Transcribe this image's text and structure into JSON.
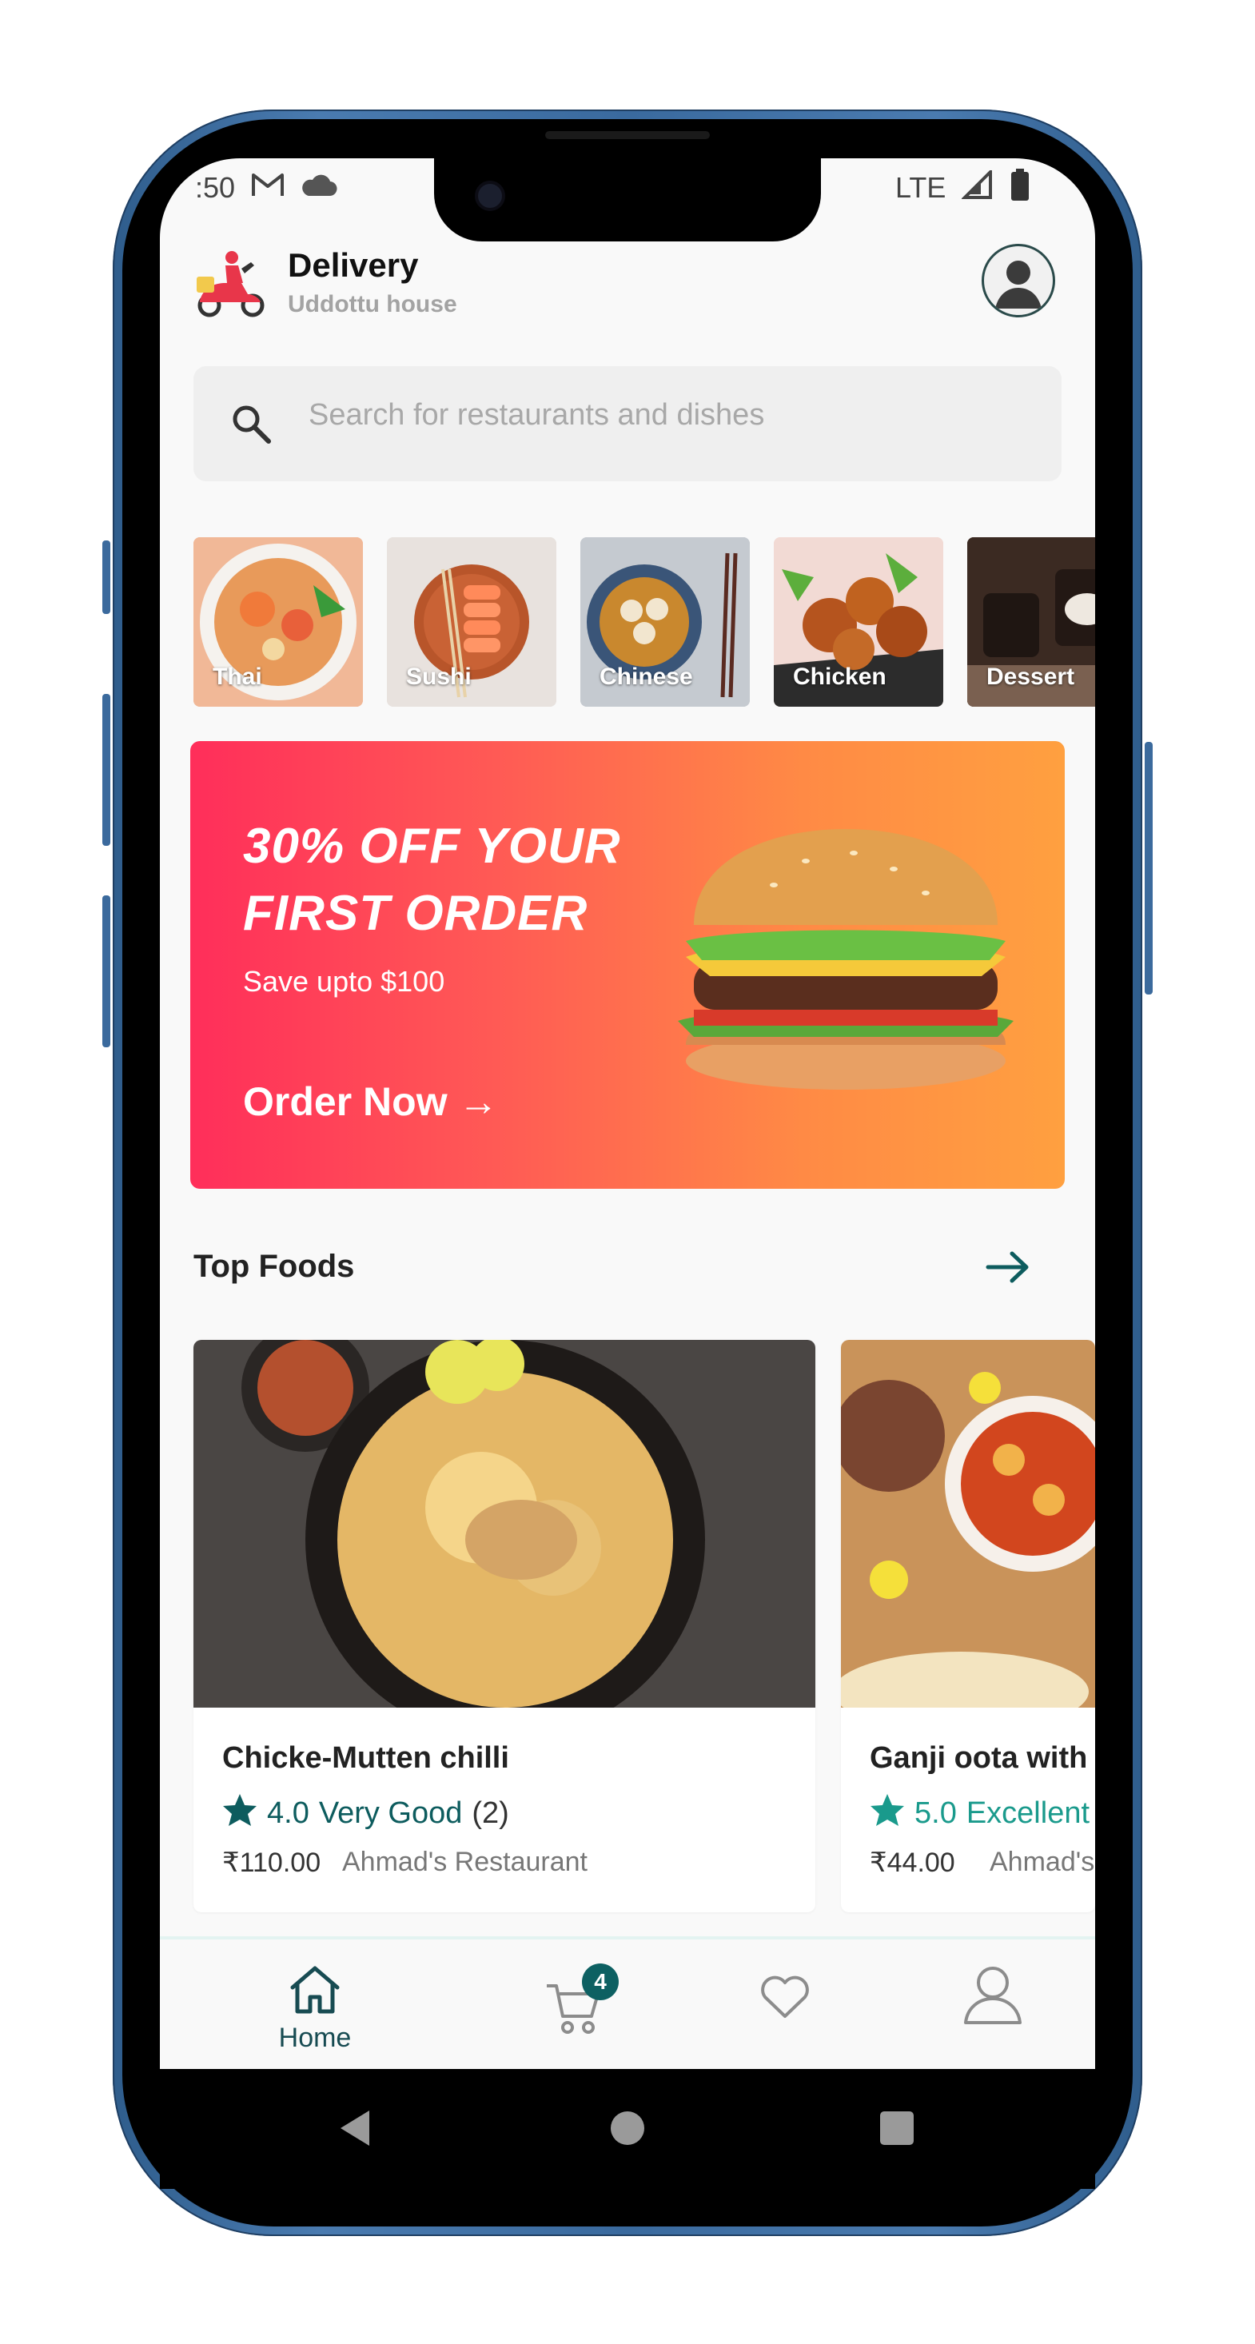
{
  "status_bar": {
    "time": ":50",
    "network": "LTE"
  },
  "header": {
    "title": "Delivery",
    "subtitle": "Uddottu house"
  },
  "search": {
    "placeholder": "Search for restaurants and dishes"
  },
  "categories": [
    {
      "label": "Thai"
    },
    {
      "label": "Sushi"
    },
    {
      "label": "Chinese"
    },
    {
      "label": "Chicken"
    },
    {
      "label": "Dessert"
    }
  ],
  "promo": {
    "headline": "30% OFF YOUR FIRST ORDER",
    "subtitle": "Save upto $100",
    "cta": "Order Now →"
  },
  "top_foods": {
    "title": "Top Foods",
    "items": [
      {
        "name": "Chicke-Mutten chilli",
        "rating": "4.0",
        "rating_label": "Very Good",
        "reviews": "(2)",
        "price": "₹110.00",
        "restaurant": "Ahmad's Restaurant",
        "rating_color": "#0d5c5e"
      },
      {
        "name": "Ganji oota with",
        "rating": "5.0",
        "rating_label": "Excellent",
        "reviews": "",
        "price": "₹44.00",
        "restaurant": "Ahmad's Restaurant",
        "rating_color": "#1a9a8c"
      }
    ]
  },
  "bottom_nav": {
    "home_label": "Home",
    "cart_count": "4"
  },
  "colors": {
    "accent": "#0d5c5e",
    "promo_start": "#ff2e5a",
    "promo_end": "#ffa040"
  }
}
